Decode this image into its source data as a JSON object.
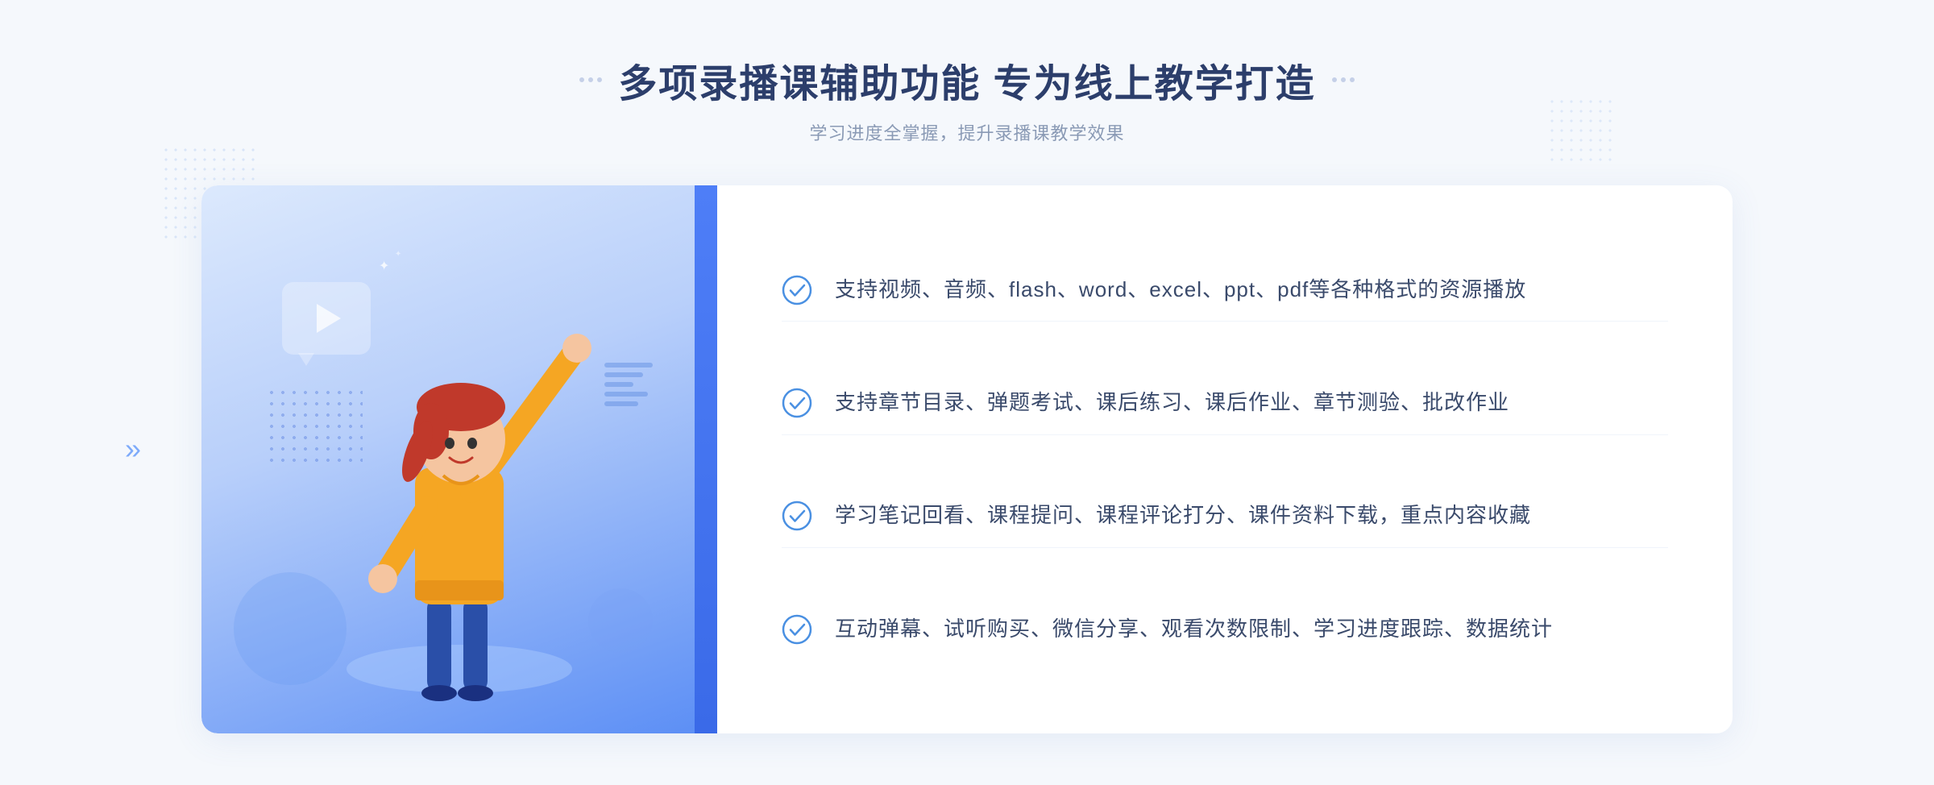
{
  "page": {
    "background_color": "#f5f8fc"
  },
  "header": {
    "title": "多项录播课辅助功能 专为线上教学打造",
    "subtitle": "学习进度全掌握，提升录播课教学效果",
    "decorator_left": "⁚",
    "decorator_right": "⁚"
  },
  "features": [
    {
      "id": 1,
      "text": "支持视频、音频、flash、word、excel、ppt、pdf等各种格式的资源播放"
    },
    {
      "id": 2,
      "text": "支持章节目录、弹题考试、课后练习、课后作业、章节测验、批改作业"
    },
    {
      "id": 3,
      "text": "学习笔记回看、课程提问、课程评论打分、课件资料下载，重点内容收藏"
    },
    {
      "id": 4,
      "text": "互动弹幕、试听购买、微信分享、观看次数限制、学习进度跟踪、数据统计"
    }
  ],
  "illustration": {
    "play_button_label": "▶"
  },
  "chevron": "»"
}
